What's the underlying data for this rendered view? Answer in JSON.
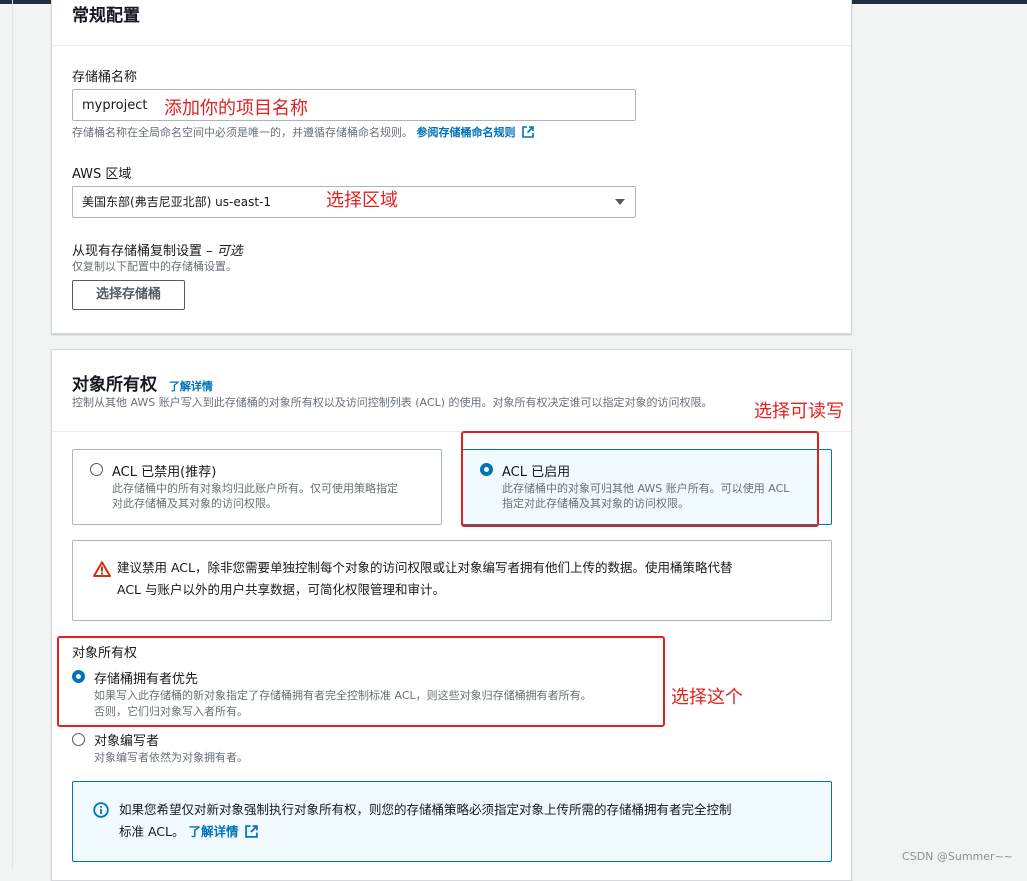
{
  "general": {
    "title": "常规配置",
    "bucket_name_label": "存储桶名称",
    "bucket_name_value": "myproject",
    "bucket_name_hint": "存储桶名称在全局命名空间中必须是唯一的，并遵循存储桶命名规则。",
    "bucket_name_rules_link": "参阅存储桶命名规则",
    "region_label": "AWS 区域",
    "region_value": "美国东部(弗吉尼亚北部) us-east-1",
    "copy_label": "从现有存储桶复制设置 –",
    "copy_optional": "可选",
    "copy_hint": "仅复制以下配置中的存储桶设置。",
    "choose_bucket_button": "选择存储桶"
  },
  "ownership": {
    "title": "对象所有权",
    "info_link": "了解详情",
    "description": "控制从其他 AWS 账户写入到此存储桶的对象所有权以及访问控制列表 (ACL) 的使用。对象所有权决定谁可以指定对象的访问权限。",
    "acl_disabled": {
      "title": "ACL 已禁用(推荐)",
      "desc_line1": "此存储桶中的所有对象均归此账户所有。仅可使用策略指定",
      "desc_line2": "对此存储桶及其对象的访问权限。"
    },
    "acl_enabled": {
      "title": "ACL 已启用",
      "desc_line1": "此存储桶中的对象可归其他 AWS 账户所有。可以使用 ACL",
      "desc_line2": "指定对此存储桶及其对象的访问权限。"
    },
    "warning_line1": "建议禁用 ACL，除非您需要单独控制每个对象的访问权限或让对象编写者拥有他们上传的数据。使用桶策略代替",
    "warning_line2": "ACL 与账户以外的用户共享数据，可简化权限管理和审计。",
    "owner_group_label": "对象所有权",
    "option_owner_preferred": {
      "title": "存储桶拥有者优先",
      "desc_line1": "如果写入此存储桶的新对象指定了存储桶拥有者完全控制标准 ACL，则这些对象归存储桶拥有者所有。",
      "desc_line2": "否则，它们归对象写入者所有。"
    },
    "option_object_writer": {
      "title": "对象编写者",
      "desc": "对象编写者依然为对象拥有者。"
    },
    "info_line1": "如果您希望仅对新对象强制执行对象所有权，则您的存储桶策略必须指定对象上传所需的存储桶拥有者完全控制",
    "info_line2": "标准 ACL。"
  },
  "annotations": {
    "project_name": "添加你的项目名称",
    "region": "选择区域",
    "read_write": "选择可读写",
    "choose_this": "选择这个"
  },
  "watermark": "CSDN @Summer~~",
  "colors": {
    "link": "#0073bb",
    "annotation": "#e32121",
    "selected_bg": "#f1faff"
  }
}
